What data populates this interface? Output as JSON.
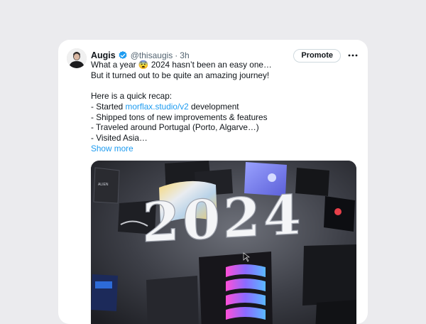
{
  "tweet": {
    "author_name": "Augis",
    "handle": "@thisaugis",
    "separator": "·",
    "time": "3h",
    "promote_label": "Promote",
    "line1_before": "What a year ",
    "line1_emoji": "😨",
    "line1_after": " 2024 hasn’t been an easy one…",
    "line2": "But it turned out to be quite an amazing journey!",
    "line3": "Here is a quick recap:",
    "line4_before": "- Started ",
    "line4_link": "morflax.studio/v2",
    "line4_after": " development",
    "line5": "- Shipped tons of new improvements & features",
    "line6": "- Traveled around Portugal (Porto, Algarve…)",
    "line7": "- Visited Asia…",
    "show_more": "Show more"
  },
  "media": {
    "year_text": "2024"
  },
  "colors": {
    "link": "#1d9bf0",
    "verified": "#1d9bf0"
  },
  "icons": {
    "verified": "verified-badge-icon",
    "more": "more-horizontal-icon"
  }
}
